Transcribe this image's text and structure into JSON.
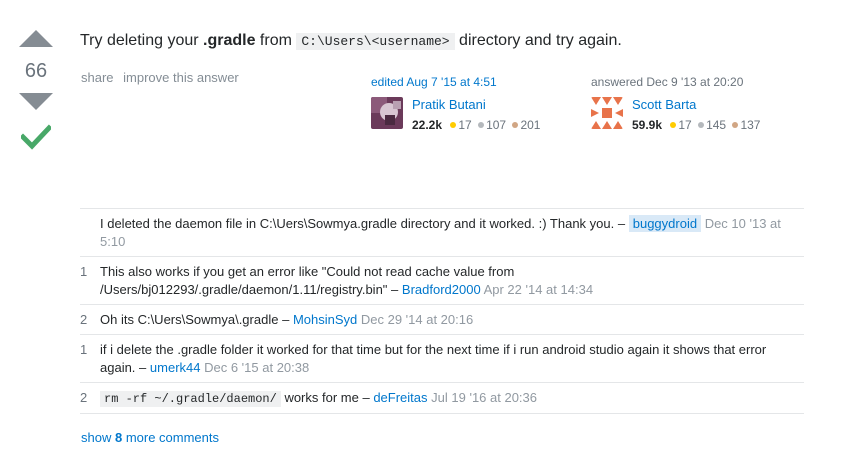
{
  "votes": {
    "count": "66"
  },
  "answer": {
    "text_before": "Try deleting your ",
    "bold": ".gradle",
    "text_mid": " from ",
    "code": "C:\\Users\\<username>",
    "text_after": " directory and try again."
  },
  "menu": {
    "share": "share",
    "improve": "improve this answer"
  },
  "editor": {
    "action": "edited Aug 7 '15 at 4:51",
    "name": "Pratik Butani",
    "rep": "22.2k",
    "gold": "17",
    "silver": "107",
    "bronze": "201"
  },
  "author": {
    "action": "answered Dec 9 '13 at 20:20",
    "name": "Scott Barta",
    "rep": "59.9k",
    "gold": "17",
    "silver": "145",
    "bronze": "137"
  },
  "comments": [
    {
      "score": "",
      "text": "I deleted the daemon file in C:\\Uers\\Sowmya.gradle directory and it worked. :) Thank you.",
      "code": "",
      "user": "buggydroid",
      "date": "Dec 10 '13 at 5:10"
    },
    {
      "score": "1",
      "text": "This also works if you get an error like \"Could not read cache value from /Users/bj012293/.gradle/daemon/1.11/registry.bin\"",
      "code": "",
      "user": "Bradford2000",
      "date": "Apr 22 '14 at 14:34"
    },
    {
      "score": "2",
      "text": "Oh its C:\\Uers\\Sowmya\\.gradle",
      "code": "",
      "user": "MohsinSyd",
      "date": "Dec 29 '14 at 20:16"
    },
    {
      "score": "1",
      "text": "if i delete the .gradle folder it worked for that time but for the next time if i run android studio again it shows that error again.",
      "code": "",
      "user": "umerk44",
      "date": "Dec 6 '15 at 20:38"
    },
    {
      "score": "2",
      "code": "rm -rf ~/.gradle/daemon/",
      "text": " works for me",
      "user": "deFreitas",
      "date": "Jul 19 '16 at 20:36"
    }
  ],
  "show_more": {
    "prefix": "show ",
    "count": "8",
    "suffix": " more comments"
  },
  "colors": {
    "link": "#0077cc",
    "accepted": "#48a868",
    "vote_arrow": "#858c93"
  },
  "icons": {
    "upvote": "arrow-up-icon",
    "downvote": "arrow-down-icon",
    "accepted": "checkmark-icon"
  }
}
